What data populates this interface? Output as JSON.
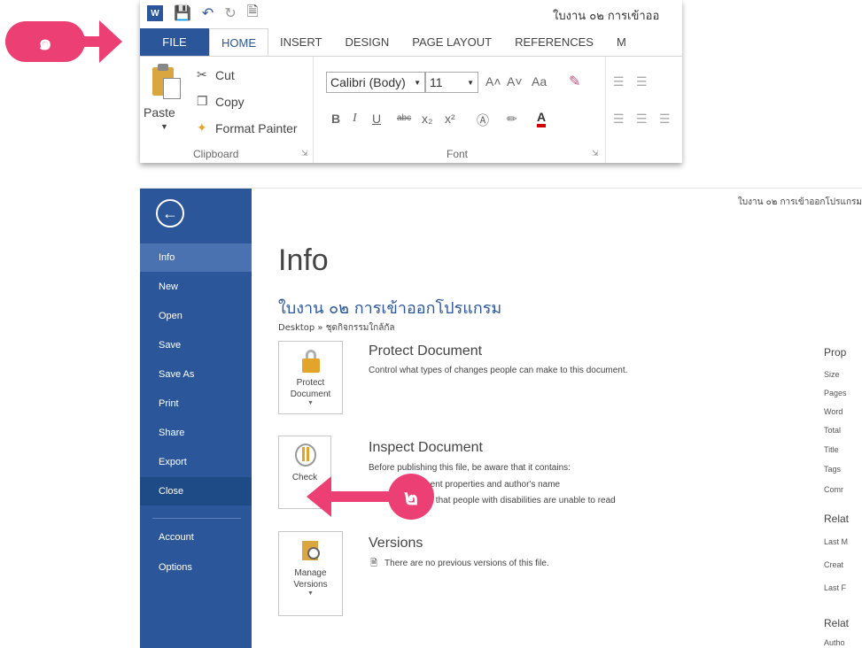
{
  "steps": {
    "step1": "๑",
    "step2": "๒"
  },
  "ribbon": {
    "title": "ใบงาน ๐๒ การเข้าออ",
    "tabs": [
      "FILE",
      "HOME",
      "INSERT",
      "DESIGN",
      "PAGE LAYOUT",
      "REFERENCES",
      "M"
    ],
    "clipboard": {
      "paste": "Paste",
      "cut": "Cut",
      "copy": "Copy",
      "format_painter": "Format Painter",
      "group_label": "Clipboard"
    },
    "font": {
      "name": "Calibri (Body)",
      "size": "11",
      "group_label": "Font",
      "bold": "B",
      "italic": "I",
      "underline": "U",
      "strike": "abc",
      "subscript": "x₂",
      "superscript": "x²",
      "grow": "A˄",
      "shrink": "A˅",
      "case": "Aa"
    }
  },
  "backstage": {
    "back_icon": "arrow-left-icon",
    "doc_title_top": "ใบงาน ๐๒ การเข้าออกโปรแกรม",
    "nav": [
      "Info",
      "New",
      "Open",
      "Save",
      "Save As",
      "Print",
      "Share",
      "Export",
      "Close",
      "Account",
      "Options"
    ],
    "heading": "Info",
    "file_name": "ใบงาน ๐๒ การเข้าออกโปรแกรม",
    "file_path": "Desktop » ชุดกิจกรรมใกล้กัล",
    "protect": {
      "button": "Protect Document",
      "title": "Protect Document",
      "desc": "Control what types of changes people can make to this document."
    },
    "inspect": {
      "button": "Check",
      "title": "Inspect Document",
      "desc": "Before publishing this file, be aware that it contains:",
      "items": [
        "Document properties and author's name",
        "Content that people with disabilities are unable to read"
      ]
    },
    "versions": {
      "button": "Manage Versions",
      "title": "Versions",
      "desc": "There are no previous versions of this file."
    },
    "properties": {
      "title": "Prop",
      "labels": [
        "Size",
        "Pages",
        "Word",
        "Total",
        "Title",
        "Tags",
        "Comr"
      ],
      "related_dates": "Relat",
      "date_labels": [
        "Last M",
        "Creat",
        "Last F"
      ],
      "related_people": "Relat",
      "people_label": "Autho"
    }
  }
}
